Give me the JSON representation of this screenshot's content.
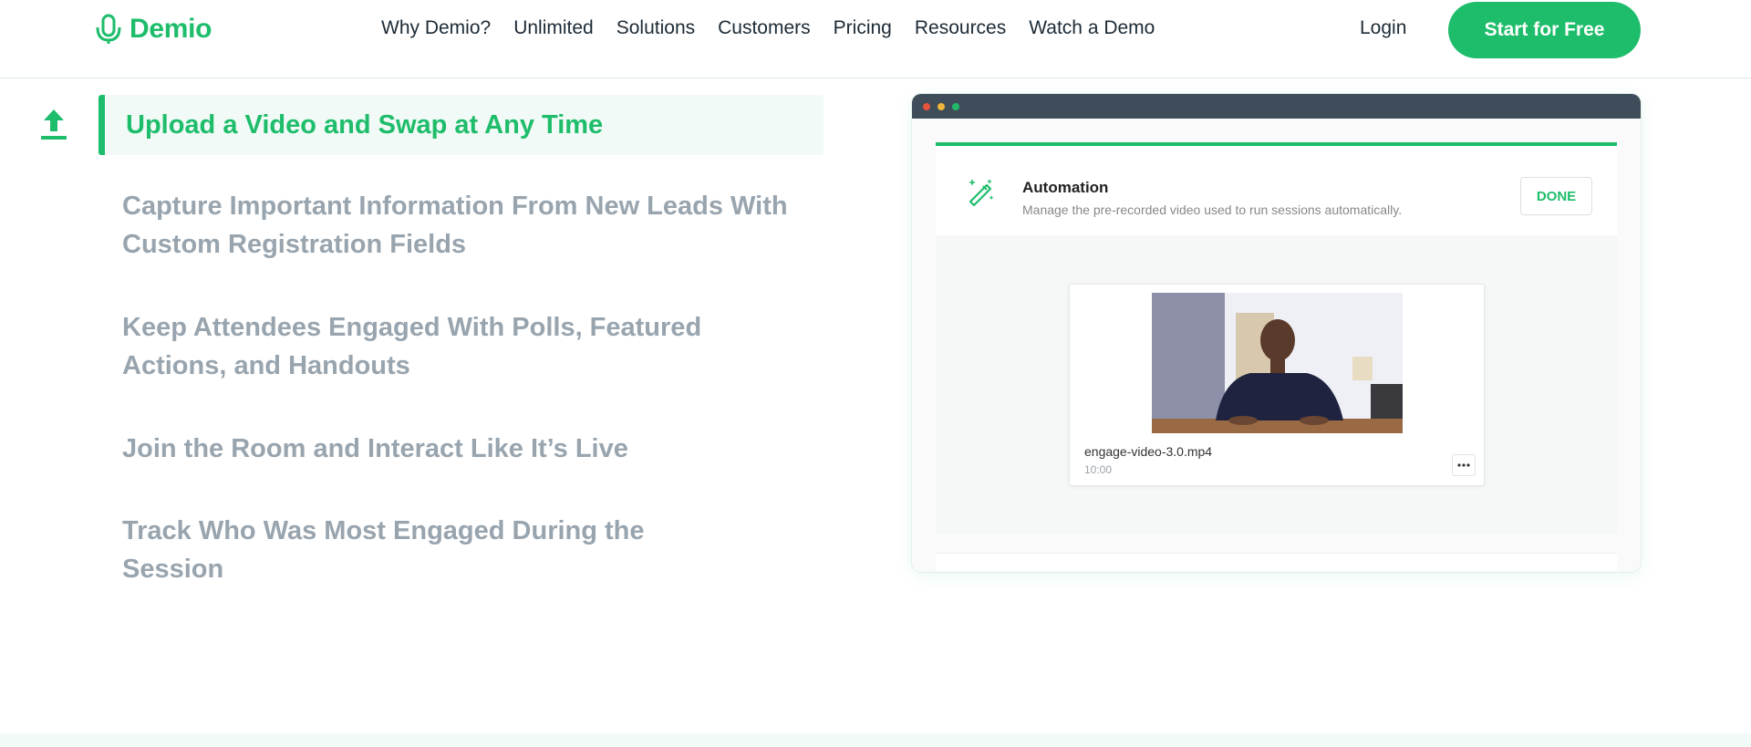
{
  "brand": {
    "name": "Demio",
    "color": "#1ebd6b"
  },
  "nav": {
    "items": [
      "Why Demio?",
      "Unlimited",
      "Solutions",
      "Customers",
      "Pricing",
      "Resources",
      "Watch a Demo"
    ],
    "login": "Login",
    "cta": "Start for Free"
  },
  "features": {
    "active_icon": "upload-icon",
    "items": [
      {
        "label": "Upload a Video and Swap at Any Time",
        "active": true
      },
      {
        "label": "Capture Important Information From New Leads With Custom Registration Fields",
        "active": false
      },
      {
        "label": "Keep Attendees Engaged With Polls, Featured Actions, and Handouts",
        "active": false
      },
      {
        "label": "Join the Room and Interact Like It’s Live",
        "active": false
      },
      {
        "label": "Track Who Was Most Engaged During the Session",
        "active": false
      }
    ]
  },
  "mockup": {
    "panel": {
      "icon": "magic-wand-icon",
      "title": "Automation",
      "subtitle": "Manage the pre-recorded video used to run sessions automatically.",
      "done": "DONE"
    },
    "video": {
      "file_name": "engage-video-3.0.mp4",
      "duration": "10:00"
    }
  }
}
